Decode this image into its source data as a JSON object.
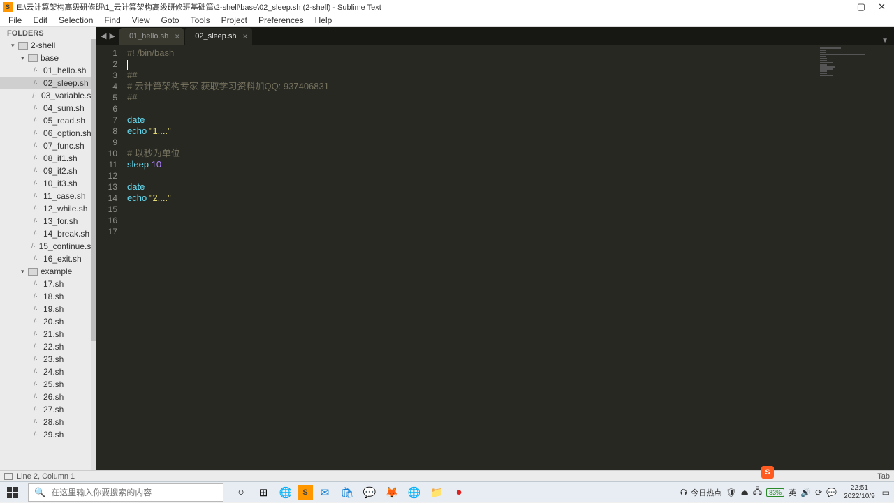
{
  "window": {
    "title": "E:\\云计算架构高级研修班\\1_云计算架构高级研修班基础篇\\2-shell\\base\\02_sleep.sh (2-shell) - Sublime Text"
  },
  "menu": [
    "File",
    "Edit",
    "Selection",
    "Find",
    "View",
    "Goto",
    "Tools",
    "Project",
    "Preferences",
    "Help"
  ],
  "sidebar": {
    "title": "FOLDERS",
    "tree": [
      {
        "type": "folder",
        "depth": 1,
        "label": "2-shell",
        "open": true
      },
      {
        "type": "folder",
        "depth": 2,
        "label": "base",
        "open": true
      },
      {
        "type": "file",
        "depth": 3,
        "label": "01_hello.sh"
      },
      {
        "type": "file",
        "depth": 3,
        "label": "02_sleep.sh",
        "selected": true
      },
      {
        "type": "file",
        "depth": 3,
        "label": "03_variable.sh"
      },
      {
        "type": "file",
        "depth": 3,
        "label": "04_sum.sh"
      },
      {
        "type": "file",
        "depth": 3,
        "label": "05_read.sh"
      },
      {
        "type": "file",
        "depth": 3,
        "label": "06_option.sh"
      },
      {
        "type": "file",
        "depth": 3,
        "label": "07_func.sh"
      },
      {
        "type": "file",
        "depth": 3,
        "label": "08_if1.sh"
      },
      {
        "type": "file",
        "depth": 3,
        "label": "09_if2.sh"
      },
      {
        "type": "file",
        "depth": 3,
        "label": "10_if3.sh"
      },
      {
        "type": "file",
        "depth": 3,
        "label": "11_case.sh"
      },
      {
        "type": "file",
        "depth": 3,
        "label": "12_while.sh"
      },
      {
        "type": "file",
        "depth": 3,
        "label": "13_for.sh"
      },
      {
        "type": "file",
        "depth": 3,
        "label": "14_break.sh"
      },
      {
        "type": "file",
        "depth": 3,
        "label": "15_continue.sh"
      },
      {
        "type": "file",
        "depth": 3,
        "label": "16_exit.sh"
      },
      {
        "type": "folder",
        "depth": 2,
        "label": "example",
        "open": true
      },
      {
        "type": "file",
        "depth": 3,
        "label": "17.sh"
      },
      {
        "type": "file",
        "depth": 3,
        "label": "18.sh"
      },
      {
        "type": "file",
        "depth": 3,
        "label": "19.sh"
      },
      {
        "type": "file",
        "depth": 3,
        "label": "20.sh"
      },
      {
        "type": "file",
        "depth": 3,
        "label": "21.sh"
      },
      {
        "type": "file",
        "depth": 3,
        "label": "22.sh"
      },
      {
        "type": "file",
        "depth": 3,
        "label": "23.sh"
      },
      {
        "type": "file",
        "depth": 3,
        "label": "24.sh"
      },
      {
        "type": "file",
        "depth": 3,
        "label": "25.sh"
      },
      {
        "type": "file",
        "depth": 3,
        "label": "26.sh"
      },
      {
        "type": "file",
        "depth": 3,
        "label": "27.sh"
      },
      {
        "type": "file",
        "depth": 3,
        "label": "28.sh"
      },
      {
        "type": "file",
        "depth": 3,
        "label": "29.sh"
      }
    ]
  },
  "tabs": [
    {
      "label": "01_hello.sh",
      "active": false
    },
    {
      "label": "02_sleep.sh",
      "active": true
    }
  ],
  "code": {
    "lines": [
      {
        "n": 1,
        "spans": [
          {
            "c": "c-comment",
            "t": "#! /bin/bash"
          }
        ]
      },
      {
        "n": 2,
        "spans": []
      },
      {
        "n": 3,
        "spans": [
          {
            "c": "c-comment",
            "t": "##"
          }
        ]
      },
      {
        "n": 4,
        "spans": [
          {
            "c": "c-comment",
            "t": "# 云计算架构专家 获取学习资料加QQ: 937406831"
          }
        ]
      },
      {
        "n": 5,
        "spans": [
          {
            "c": "c-comment",
            "t": "##"
          }
        ]
      },
      {
        "n": 6,
        "spans": []
      },
      {
        "n": 7,
        "spans": [
          {
            "c": "c-cmd",
            "t": "date"
          }
        ]
      },
      {
        "n": 8,
        "spans": [
          {
            "c": "c-cmd",
            "t": "echo"
          },
          {
            "c": "",
            "t": " "
          },
          {
            "c": "c-str",
            "t": "\"1....\""
          }
        ]
      },
      {
        "n": 9,
        "spans": []
      },
      {
        "n": 10,
        "spans": [
          {
            "c": "c-comment",
            "t": "# 以秒为单位"
          }
        ]
      },
      {
        "n": 11,
        "spans": [
          {
            "c": "c-cmd",
            "t": "sleep"
          },
          {
            "c": "",
            "t": " "
          },
          {
            "c": "c-num",
            "t": "10"
          }
        ]
      },
      {
        "n": 12,
        "spans": []
      },
      {
        "n": 13,
        "spans": [
          {
            "c": "c-cmd",
            "t": "date"
          }
        ]
      },
      {
        "n": 14,
        "spans": [
          {
            "c": "c-cmd",
            "t": "echo"
          },
          {
            "c": "",
            "t": " "
          },
          {
            "c": "c-str",
            "t": "\"2....\""
          }
        ]
      },
      {
        "n": 15,
        "spans": []
      },
      {
        "n": 16,
        "spans": []
      },
      {
        "n": 17,
        "spans": []
      }
    ],
    "cursor_line": 2
  },
  "status": {
    "left": "Line 2, Column 1",
    "right_tab": "Tab"
  },
  "taskbar": {
    "search_placeholder": "在这里输入你要搜索的内容",
    "tray": {
      "hot": "今日热点",
      "battery": "83%",
      "ime": "英",
      "time": "22:51",
      "date": "2022/10/9"
    }
  },
  "ime_badge": "S"
}
